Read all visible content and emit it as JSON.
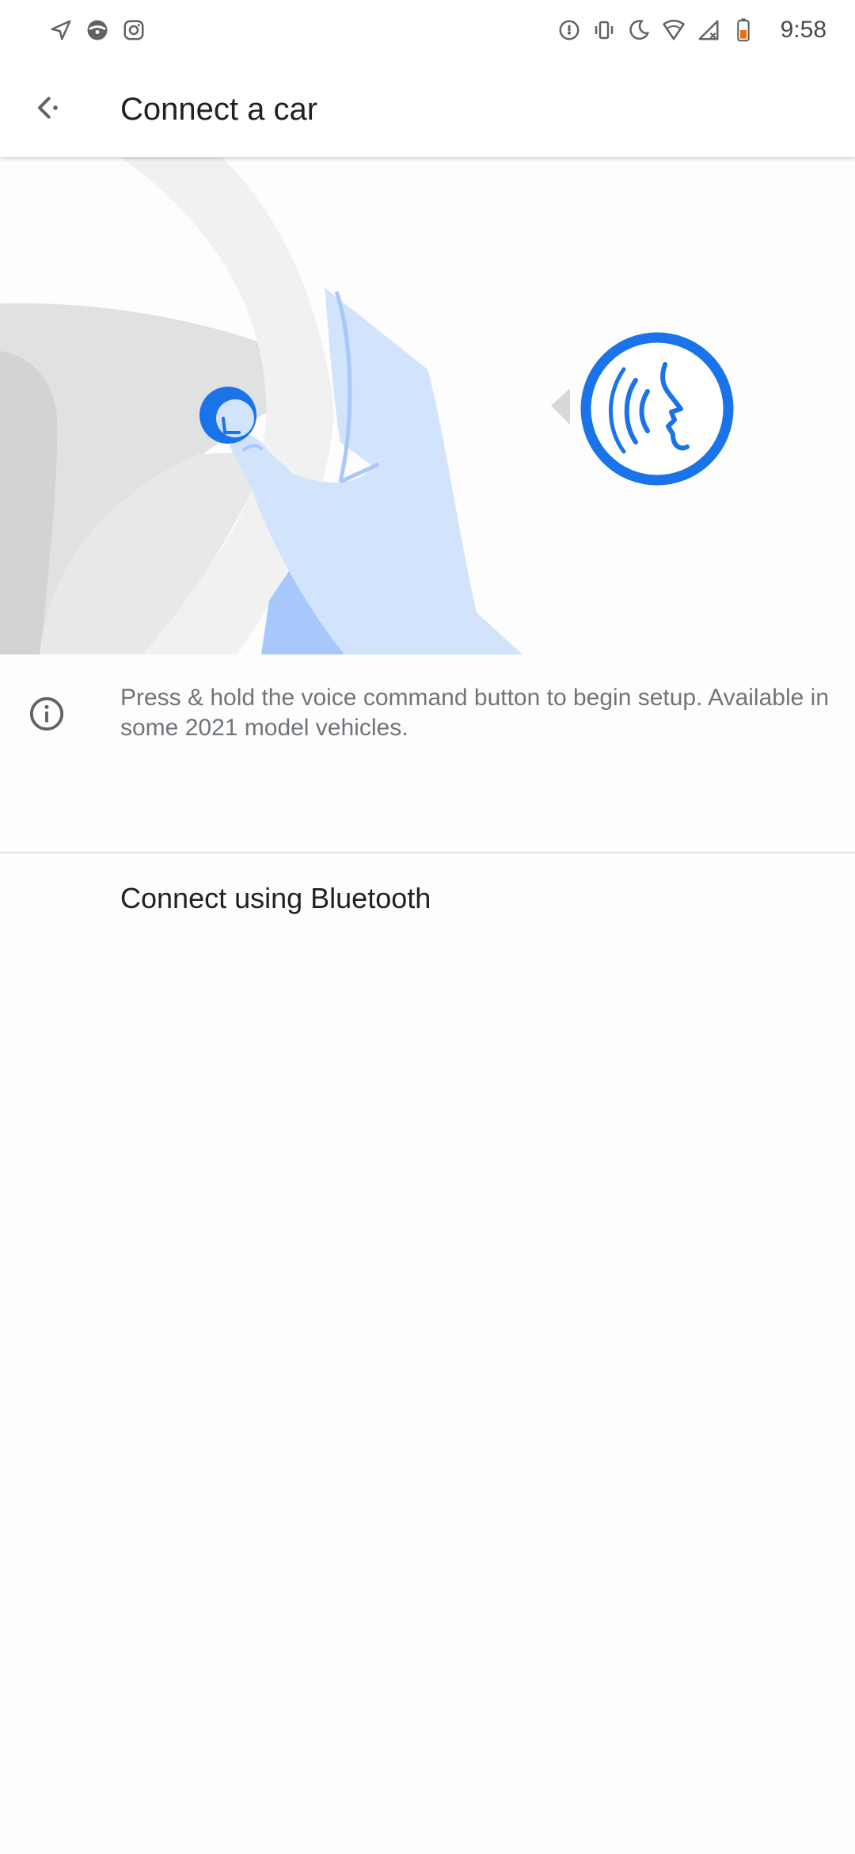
{
  "status_bar": {
    "time": "9:58",
    "left_icons": [
      "navigation-icon",
      "steering-wheel-icon",
      "instagram-icon"
    ],
    "right_icons": [
      "data-saver-icon",
      "vibrate-icon",
      "do-not-disturb-icon",
      "wifi-icon",
      "signal-off-icon",
      "battery-low-icon"
    ],
    "battery_color": "#e8710a"
  },
  "app_bar": {
    "title": "Connect a car"
  },
  "illustration": {
    "accent_color": "#1a73e8",
    "hand_color": "#d2e3fc",
    "wheel_color": "#f1f1f1"
  },
  "info": {
    "text": "Press & hold the voice command button to begin setup. Available in some 2021 model vehicles."
  },
  "actions": {
    "bluetooth_label": "Connect using Bluetooth"
  }
}
